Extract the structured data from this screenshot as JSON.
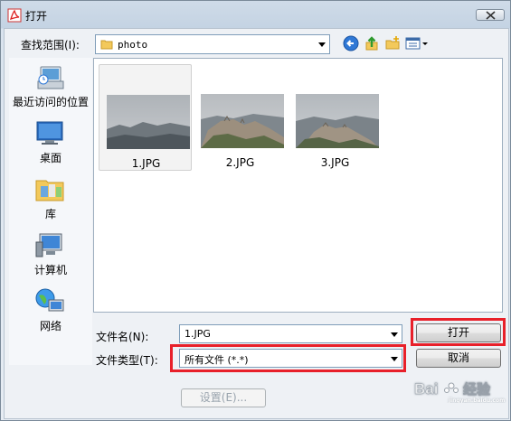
{
  "window": {
    "title": "打开"
  },
  "lookin": {
    "label": "查找范围(I):",
    "value": "photo"
  },
  "places": [
    {
      "label": "最近访问的位置",
      "icon": "recent-places-icon"
    },
    {
      "label": "桌面",
      "icon": "desktop-icon"
    },
    {
      "label": "库",
      "icon": "libraries-icon"
    },
    {
      "label": "计算机",
      "icon": "computer-icon"
    },
    {
      "label": "网络",
      "icon": "network-icon"
    }
  ],
  "files": [
    {
      "name": "1.JPG",
      "selected": true
    },
    {
      "name": "2.JPG",
      "selected": false
    },
    {
      "name": "3.JPG",
      "selected": false
    }
  ],
  "filename": {
    "label": "文件名(N):",
    "value": "1.JPG"
  },
  "filetype": {
    "label": "文件类型(T):",
    "value": "所有文件 (*.*)"
  },
  "buttons": {
    "open": "打开",
    "cancel": "取消",
    "settings": "设置(E)..."
  },
  "watermark": {
    "text": "Bai 经验",
    "url": "jingyan.baidu.com"
  },
  "colors": {
    "highlight": "#e8202a",
    "selection": "#f3f3f3"
  }
}
